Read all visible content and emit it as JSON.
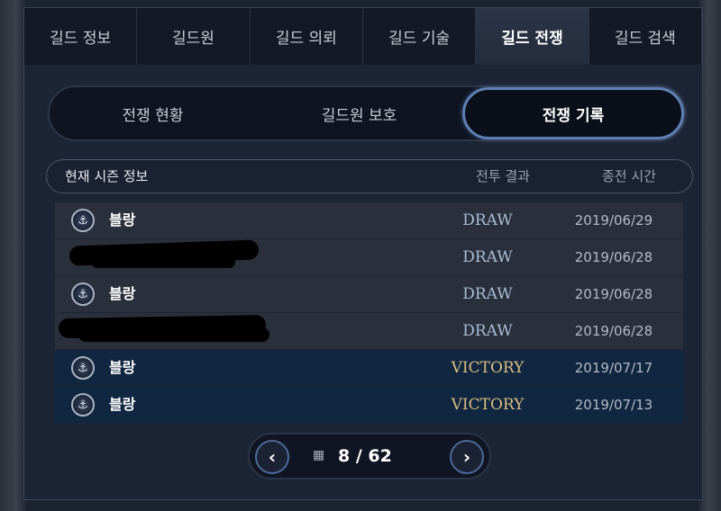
{
  "top_tabs": [
    "길드 정보",
    "길드원",
    "길드 의뢰",
    "길드 기술",
    "길드 전쟁",
    "길드 검색"
  ],
  "active_top_tab": "길드 전쟁",
  "sub_tabs": [
    "전쟁 현황",
    "길드원 보호",
    "전쟁 기록"
  ],
  "active_sub_tab": "전쟁 기록",
  "table": {
    "headers": {
      "info": "현재 시즌 정보",
      "result": "전투 결과",
      "time": "종전 시간"
    },
    "rows": [
      {
        "guild": "블랑",
        "result": "DRAW",
        "date": "2019/06/29",
        "redacted": false
      },
      {
        "guild": "",
        "result": "DRAW",
        "date": "2019/06/28",
        "redacted": true
      },
      {
        "guild": "블랑",
        "result": "DRAW",
        "date": "2019/06/28",
        "redacted": false
      },
      {
        "guild": "",
        "result": "DRAW",
        "date": "2019/06/28",
        "redacted": true
      },
      {
        "guild": "블랑",
        "result": "VICTORY",
        "date": "2019/07/17",
        "redacted": false
      },
      {
        "guild": "블랑",
        "result": "VICTORY",
        "date": "2019/07/13",
        "redacted": false
      }
    ]
  },
  "pagination": {
    "text": "8 / 62",
    "prev_icon": "chevron-left-icon",
    "next_icon": "chevron-right-icon",
    "grid_icon": "grid-icon"
  },
  "colors": {
    "victory_text": "#d9bf82",
    "draw_text": "#a9bdd8",
    "victory_row": "#112641",
    "draw_row": "#2a303b",
    "active_outline": "#5f7fb4"
  }
}
